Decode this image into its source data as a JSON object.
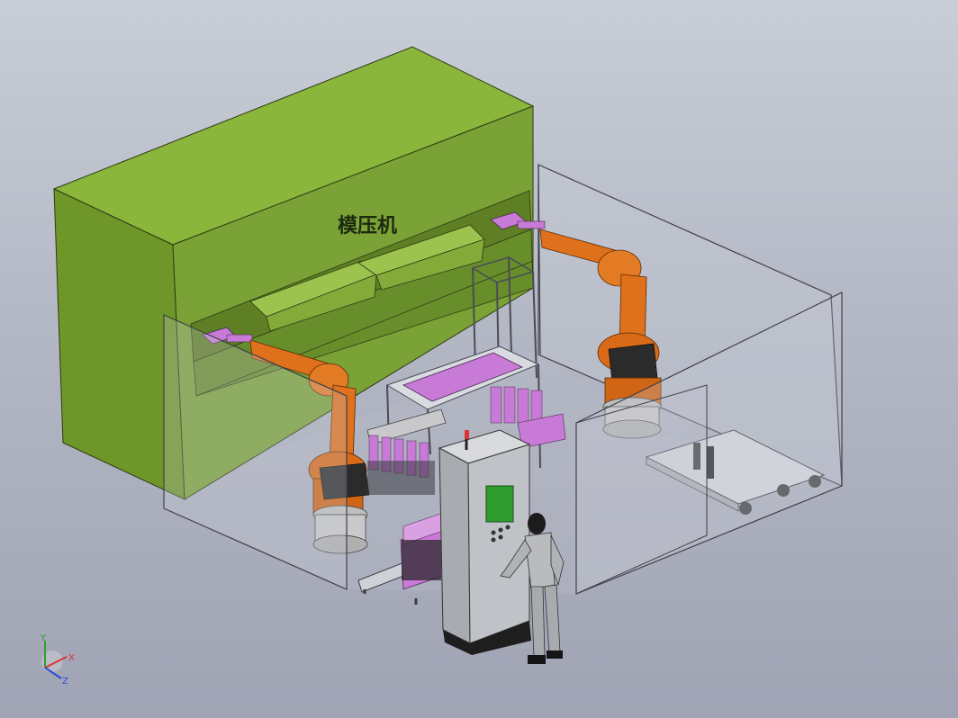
{
  "scene": {
    "press_label": "模压机",
    "triad": {
      "x_label": "X",
      "y_label": "Y",
      "z_label": "Z"
    }
  },
  "colors": {
    "press_green": "#7aa236",
    "press_green_dark": "#5e7f24",
    "robot_orange": "#e0711c",
    "tool_magenta": "#c77ad6",
    "enclosure_glass": "#c6cad3",
    "cabinet_gray": "#b9bcc0",
    "screen_green": "#2f9c2f"
  }
}
